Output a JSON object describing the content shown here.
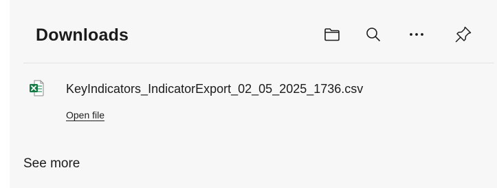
{
  "header": {
    "title": "Downloads",
    "actions": [
      {
        "name": "open-downloads-folder-button",
        "icon": "folder-icon"
      },
      {
        "name": "search-downloads-button",
        "icon": "search-icon"
      },
      {
        "name": "more-options-button",
        "icon": "more-horizontal-icon"
      },
      {
        "name": "pin-button",
        "icon": "pin-icon"
      }
    ]
  },
  "downloads": [
    {
      "file_name": "KeyIndicators_IndicatorExport_02_05_2025_1736.csv",
      "action_label": "Open file",
      "icon": "excel-file-icon"
    }
  ],
  "footer": {
    "see_more_label": "See more"
  },
  "colors": {
    "panel_background": "#f7f7f7",
    "text": "#1b1b1b",
    "excel_green": "#107c41",
    "divider": "#e3e3e3"
  }
}
